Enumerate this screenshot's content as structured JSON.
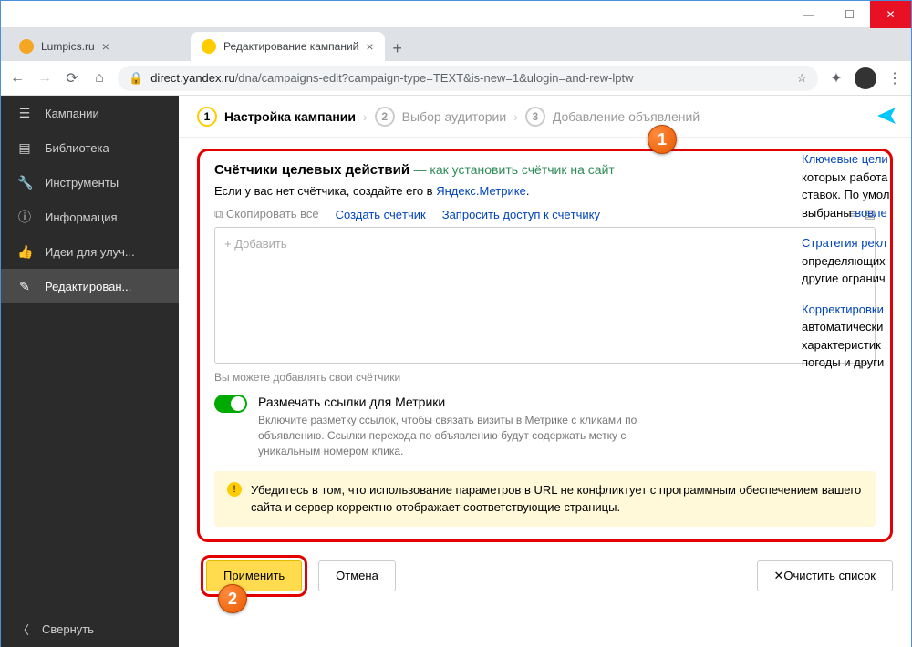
{
  "tabs": [
    {
      "title": "Lumpics.ru",
      "favcolor": "#f5a623"
    },
    {
      "title": "Редактирование кампаний",
      "favcolor": "#ffcc00"
    }
  ],
  "url": {
    "host": "direct.yandex.ru",
    "path": "/dna/campaigns-edit?campaign-type=TEXT&is-new=1&ulogin=and-rew-lptw"
  },
  "sidebar": {
    "items": [
      {
        "icon": "☰",
        "label": "Кампании"
      },
      {
        "icon": "▤",
        "label": "Библиотека"
      },
      {
        "icon": "🔧",
        "label": "Инструменты"
      },
      {
        "icon": "ⓘ",
        "label": "Информация"
      },
      {
        "icon": "👍",
        "label": "Идеи для улуч..."
      },
      {
        "icon": "✎",
        "label": "Редактирован..."
      }
    ],
    "collapse": "Свернуть"
  },
  "stepper": {
    "s1": "Настройка кампании",
    "s2": "Выбор аудитории",
    "s3": "Добавление объявлений"
  },
  "section": {
    "title": "Счётчики целевых действий",
    "help": "— как установить счётчик на сайт",
    "desc_pre": "Если у вас нет счётчика, создайте его в ",
    "desc_link": "Яндекс.Метрике",
    "copy_all": "Скопировать все",
    "create": "Создать счётчик",
    "request": "Запросить доступ к счётчику",
    "add_placeholder": "+  Добавить",
    "hint": "Вы можете добавлять свои счётчики",
    "toggle_title": "Размечать ссылки для Метрики",
    "toggle_desc": "Включите разметку ссылок, чтобы связать визиты в Метрике с кликами по объявлению. Ссылки перехода по объявлению будут содержать метку с уникальным номером клика.",
    "warn": "Убедитесь в том, что использование параметров в URL не конфликтует с программным обеспечением вашего сайта и сервер корректно отображает соответствующие страницы."
  },
  "buttons": {
    "apply": "Применить",
    "cancel": "Отмена",
    "clear": "Очистить список"
  },
  "right": {
    "p1a": "Ключевые цели",
    "p1b": " которых работа ставок. По умол выбраны ",
    "p1c": "вовле",
    "p2a": "Стратегия рекл",
    "p2b": " определяющих другие огранич",
    "p3a": "Корректировки",
    "p3b": " автоматически характеристик погоды и други"
  }
}
